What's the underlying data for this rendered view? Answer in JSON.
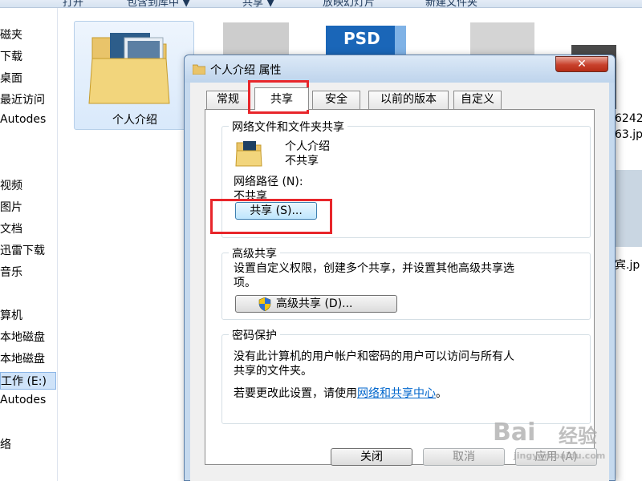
{
  "explorer": {
    "toolbar": [
      "打开",
      "包含到库中 ▼",
      "共享 ▼",
      "放映幻灯片",
      "新建文件夹"
    ],
    "nav_items": [
      "磁夹",
      "下载",
      "桌面",
      "最近访问",
      "Autodes",
      "",
      "视频",
      "图片",
      "文档",
      "迅雷下载",
      "音乐",
      "",
      "算机",
      "本地磁盘",
      "本地磁盘",
      "工作 (E:)",
      "Autodes",
      "",
      "络"
    ],
    "folder_label": "个人介绍",
    "psd_label": "PSD",
    "file_fragment_1": "6242",
    "file_fragment_2": "63.jp",
    "file_fragment_3": "宾.jp"
  },
  "dialog": {
    "title": "个人介绍 属性",
    "close_label": "✕",
    "tabs": [
      "常规",
      "共享",
      "安全",
      "以前的版本",
      "自定义"
    ],
    "active_tab": "共享",
    "network_sharing": {
      "group_title": "网络文件和文件夹共享",
      "folder_name": "个人介绍",
      "share_status": "不共享",
      "path_label": "网络路径 (N):",
      "path_value": "不共享",
      "share_button": "共享 (S)..."
    },
    "advanced_sharing": {
      "group_title": "高级共享",
      "description_line1": "设置自定义权限，创建多个共享，并设置其他高级共享选",
      "description_line2": "项。",
      "button": "高级共享 (D)..."
    },
    "password_protection": {
      "group_title": "密码保护",
      "text_line1": "没有此计算机的用户帐户和密码的用户可以访问与所有人",
      "text_line2": "共享的文件夹。",
      "change_prefix": "若要更改此设置，请使用",
      "change_link": "网络和共享中心",
      "change_suffix": "。"
    },
    "buttons": {
      "close": "关闭",
      "cancel": "取消",
      "apply": "应用 (A)"
    }
  },
  "watermark": {
    "brand": "Bai",
    "suffix": "经验",
    "url": "jingyan.baidu.com"
  },
  "colors": {
    "highlight": "#e8262b",
    "link": "#0066cc",
    "close_button": "#c8412c"
  }
}
